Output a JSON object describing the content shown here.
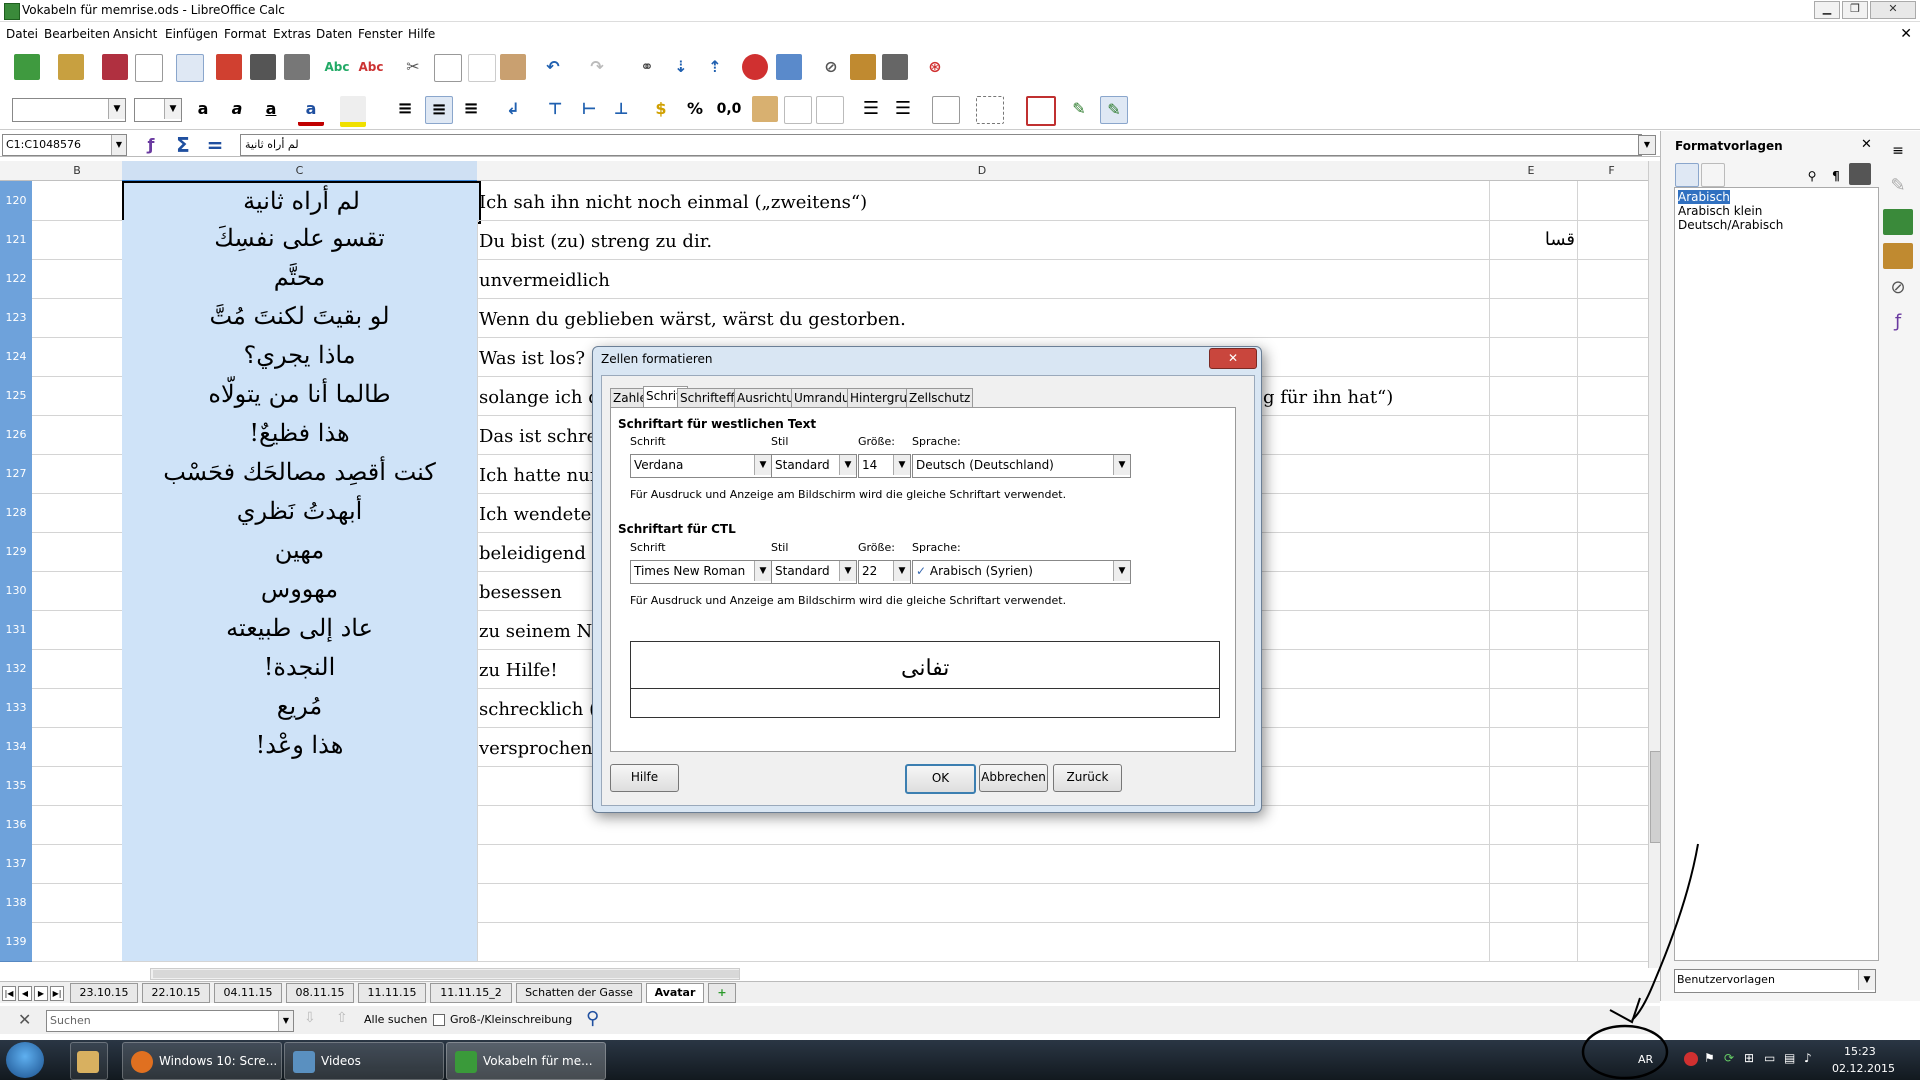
{
  "window": {
    "title": "Vokabeln für memrise.ods - LibreOffice Calc",
    "controls": [
      "▁",
      "❐",
      "✕"
    ]
  },
  "menu": {
    "items": [
      "Datei",
      "Bearbeiten",
      "Ansicht",
      "Einfügen",
      "Format",
      "Extras",
      "Daten",
      "Fenster",
      "Hilfe"
    ],
    "close_doc": "✕"
  },
  "toolbar": {
    "percent": "%",
    "decimal": "0,0"
  },
  "formula_bar": {
    "name_box": "C1:C1048576",
    "content": "لم أراه ثانية"
  },
  "grid": {
    "columns": [
      "B",
      "C",
      "D",
      "E",
      "F"
    ],
    "rows": [
      {
        "num": "120",
        "c": "لم أراه ثانية",
        "d": "Ich sah ihn nicht noch einmal („zweitens“)",
        "e": ""
      },
      {
        "num": "121",
        "c": "تقسو على نفسِكَ",
        "d": "Du bist (zu) streng zu dir.",
        "e": "قسا"
      },
      {
        "num": "122",
        "c": "محتَّم",
        "d": "unvermeidlich",
        "e": ""
      },
      {
        "num": "123",
        "c": "لو بقيتَ لكنتَ مُتَّ",
        "d": "Wenn du geblieben wärst, wärst du gestorben.",
        "e": ""
      },
      {
        "num": "124",
        "c": "ماذا يجري؟",
        "d": "Was ist los?",
        "e": ""
      },
      {
        "num": "125",
        "c": "طالما أنا من يتولّاه",
        "d": "solange ich d",
        "d_tail": "g für ihn hat“)",
        "e": ""
      },
      {
        "num": "126",
        "c": "هذا فظيعٌ!",
        "d": "Das ist schre",
        "e": ""
      },
      {
        "num": "127",
        "c": "كنت أقصِد مصالحَك فحَسْب",
        "d": "Ich hatte nur",
        "e": ""
      },
      {
        "num": "128",
        "c": "أبهدتُ نَظري",
        "d": "Ich wendete",
        "e": ""
      },
      {
        "num": "129",
        "c": "مهين",
        "d": "beleidigend",
        "e": ""
      },
      {
        "num": "130",
        "c": "مهووس",
        "d": "besessen",
        "e": ""
      },
      {
        "num": "131",
        "c": "عاد إلى طبيعته",
        "d": "zu seinem N",
        "e": ""
      },
      {
        "num": "132",
        "c": "النجدة!",
        "d": "zu Hilfe!",
        "e": ""
      },
      {
        "num": "133",
        "c": "مُريع",
        "d": "schrecklich (",
        "e": ""
      },
      {
        "num": "134",
        "c": "هذا وعْد!",
        "d": "versprochen",
        "e": ""
      },
      {
        "num": "135",
        "c": "",
        "d": "",
        "e": ""
      },
      {
        "num": "136",
        "c": "",
        "d": "",
        "e": ""
      },
      {
        "num": "137",
        "c": "",
        "d": "",
        "e": ""
      },
      {
        "num": "138",
        "c": "",
        "d": "",
        "e": ""
      },
      {
        "num": "139",
        "c": "",
        "d": "",
        "e": ""
      }
    ]
  },
  "sheet_tabs": {
    "nav": [
      "|◀",
      "◀",
      "▶",
      "▶|"
    ],
    "tabs": [
      "23.10.15",
      "22.10.15",
      "04.11.15",
      "08.11.15",
      "11.11.15",
      "11.11.15_2",
      "Schatten der Gasse",
      "Avatar"
    ],
    "active": "Avatar",
    "add": "+"
  },
  "find_bar": {
    "close": "✕",
    "placeholder": "Suchen",
    "find_all": "Alle suchen",
    "match_case": "Groß-/Kleinschreibung"
  },
  "sidebar": {
    "title": "Formatvorlagen",
    "close": "✕",
    "styles": [
      "Arabisch",
      "Arabisch klein",
      "Deutsch/Arabisch"
    ],
    "selected_style": "Arabisch",
    "filter": "Benutzervorlagen"
  },
  "dialog": {
    "title": "Zellen formatieren",
    "close": "✕",
    "tabs": [
      "Zahlen",
      "Schrift",
      "Schrifteffekt",
      "Ausrichtung",
      "Umrandung",
      "Hintergrund",
      "Zellschutz"
    ],
    "active_tab": "Schrift",
    "western": {
      "heading": "Schriftart für westlichen Text",
      "font_label": "Schrift",
      "style_label": "Stil",
      "size_label": "Größe:",
      "lang_label": "Sprache:",
      "font": "Verdana",
      "style": "Standard",
      "size": "14",
      "language": "Deutsch (Deutschland)",
      "note": "Für Ausdruck und Anzeige am Bildschirm wird die gleiche Schriftart verwendet."
    },
    "ctl": {
      "heading": "Schriftart für CTL",
      "font_label": "Schrift",
      "style_label": "Stil",
      "size_label": "Größe:",
      "lang_label": "Sprache:",
      "font": "Times New Roman",
      "style": "Standard",
      "size": "22",
      "language": "Arabisch (Syrien)",
      "note": "Für Ausdruck und Anzeige am Bildschirm wird die gleiche Schriftart verwendet."
    },
    "preview_text": "تفانى",
    "buttons": {
      "help": "Hilfe",
      "ok": "OK",
      "cancel": "Abbrechen",
      "reset": "Zurück"
    }
  },
  "taskbar": {
    "items": [
      "Windows 10: Scre...",
      "Videos",
      "Vokabeln für me..."
    ],
    "language": "AR",
    "time": "15:23",
    "date": "02.12.2015"
  },
  "colors": {
    "selection": "#cfe3f8",
    "row_header": "#6ea2db",
    "dialog_frame": "#d9e6f3",
    "taskbar": "#1c2530"
  }
}
